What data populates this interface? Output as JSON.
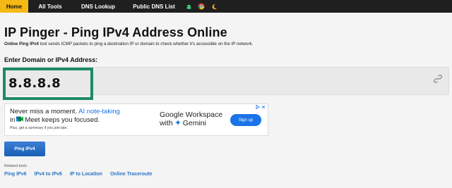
{
  "nav": {
    "items": [
      {
        "label": "Home",
        "active": true
      },
      {
        "label": "All Tools"
      },
      {
        "label": "DNS Lookup"
      },
      {
        "label": "Public DNS List"
      }
    ],
    "icons": [
      "android-icon",
      "chrome-icon",
      "moon-icon"
    ]
  },
  "page": {
    "title": "IP Pinger - Ping IPv4 Address Online",
    "desc_bold": "Online Ping IPv4",
    "desc_rest": " tool sends ICMP packets to ping a destination IP or domain to check whether it's accessible on the IP network.",
    "input_label": "Enter Domain or IPv4 Address:",
    "input_value": "8.8.8.8",
    "ping_button": "Ping IPv4"
  },
  "ad": {
    "line1_a": "Never miss a moment.",
    "line1_b": " AI note-taking",
    "line2_a": "in",
    "line2_b": "Meet keeps you focused.",
    "line3": "Plus, get a summary if you join late.",
    "brand_line1": "Google Workspace",
    "brand_line2_a": "with",
    "brand_line2_b": "Gemini",
    "signup": "Sign up"
  },
  "related": {
    "title": "Related tools",
    "links": [
      "Ping IPv6",
      "IPv4 to IPv6",
      "IP to Location",
      "Online Traceroute"
    ]
  },
  "colors": {
    "nav_bg": "#1f1f1f",
    "nav_active": "#f5b916",
    "highlight_border": "#1e8a64",
    "button_blue": "#1a5fb4",
    "link_blue": "#2b74c6"
  }
}
